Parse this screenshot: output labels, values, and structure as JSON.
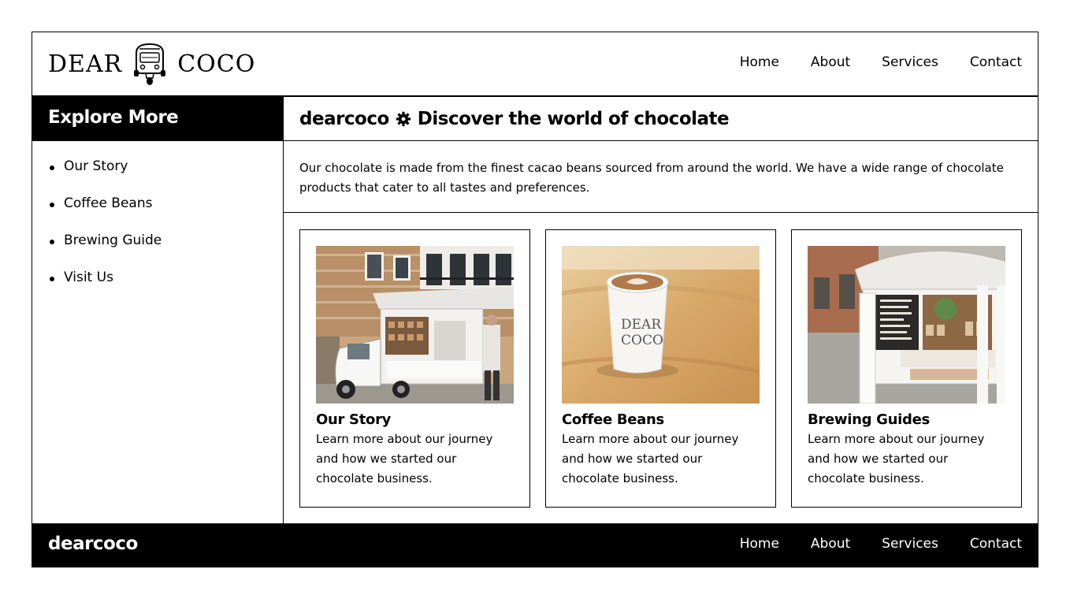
{
  "header": {
    "logo_left": "DEAR",
    "logo_right": "COCO",
    "nav": [
      "Home",
      "About",
      "Services",
      "Contact"
    ]
  },
  "sidebar": {
    "title": "Explore More",
    "items": [
      "Our Story",
      "Coffee Beans",
      "Brewing Guide",
      "Visit Us"
    ]
  },
  "main": {
    "brand": "dearcoco",
    "title": "Discover the world of chocolate",
    "intro": "Our chocolate is made from the finest cacao beans sourced from around the world. We have a wide range of chocolate products that cater to all tastes and preferences.",
    "cards": [
      {
        "title": "Our Story",
        "text": "Learn more about our journey and how we started our chocolate business.",
        "image": "coffee-truck-photo"
      },
      {
        "title": "Coffee Beans",
        "text": "Learn more about our journey and how we started our chocolate business.",
        "image": "latte-cup-photo",
        "cup_text_1": "DEAR",
        "cup_text_2": "COCO"
      },
      {
        "title": "Brewing Guides",
        "text": "Learn more about our journey and how we started our chocolate business.",
        "image": "coffee-truck-counter-photo"
      }
    ]
  },
  "footer": {
    "brand": "dearcoco",
    "nav": [
      "Home",
      "About",
      "Services",
      "Contact"
    ]
  },
  "icons": {
    "logo_mark": "tuk-tuk-icon",
    "title_icon": "gear-icon"
  },
  "colors": {
    "primary": "#000000",
    "background": "#ffffff"
  }
}
